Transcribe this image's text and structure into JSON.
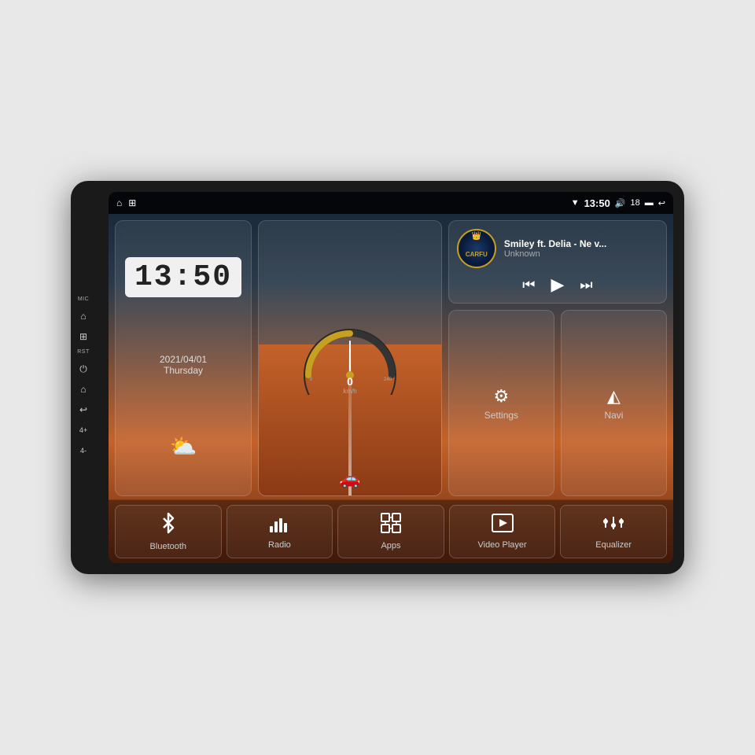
{
  "device": {
    "background": "#1a1a1a"
  },
  "status_bar": {
    "wifi_icon": "▼",
    "time": "13:50",
    "volume_icon": "🔊",
    "volume_level": "18",
    "window_icon": "▬",
    "back_icon": "↩",
    "home_icon": "⌂",
    "apps_icon": "⊞"
  },
  "side_buttons": {
    "mic_label": "MIC",
    "rst_label": "RST",
    "power_icon": "⏻",
    "home_icon": "⌂",
    "back_icon": "↩",
    "vol_up": "4+",
    "vol_down": "4-"
  },
  "clock_widget": {
    "time": "13:50",
    "date": "2021/04/01",
    "day": "Thursday",
    "weather_icon": "⛅"
  },
  "speedometer": {
    "speed": "0",
    "unit": "km/h",
    "max": "240"
  },
  "music_widget": {
    "logo_text": "CARFU",
    "title": "Smiley ft. Delia - Ne v...",
    "artist": "Unknown",
    "prev_icon": "⏮",
    "play_icon": "▶",
    "next_icon": "⏭"
  },
  "app_buttons": [
    {
      "label": "Settings",
      "icon": "⚙"
    },
    {
      "label": "Navi",
      "icon": "◭"
    }
  ],
  "bottom_apps": [
    {
      "label": "Bluetooth",
      "icon": "bluetooth"
    },
    {
      "label": "Radio",
      "icon": "radio"
    },
    {
      "label": "Apps",
      "icon": "apps"
    },
    {
      "label": "Video Player",
      "icon": "video"
    },
    {
      "label": "Equalizer",
      "icon": "equalizer"
    }
  ]
}
